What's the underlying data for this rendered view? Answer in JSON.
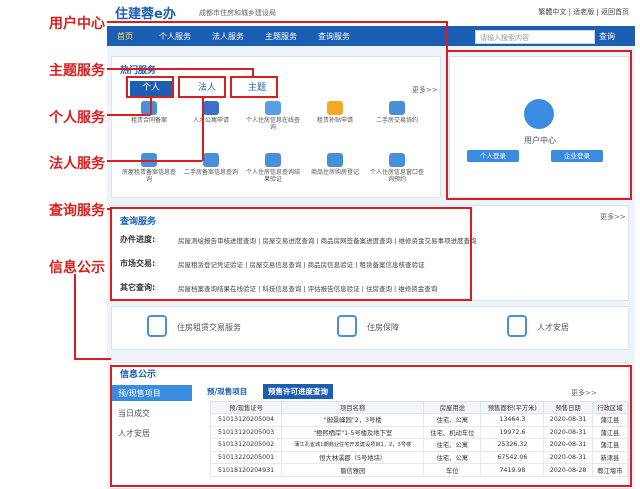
{
  "callouts": [
    "用户中心",
    "主题服务",
    "个人服务",
    "法人服务",
    "查询服务",
    "信息公示"
  ],
  "header": {
    "logo": "住建蓉e办",
    "subtitle": "成都市住房和城乡建设局",
    "toplinks": "繁體中文 | 适老版 | 返回首页"
  },
  "nav": {
    "items": [
      "首页",
      "个人服务",
      "法人服务",
      "主题服务",
      "查询服务"
    ],
    "search_placeholder": "请输入搜索内容",
    "search_label": "查询"
  },
  "hot": {
    "title": "热门服务",
    "tabs": [
      "个人",
      "法人",
      "主题"
    ],
    "more": "更多>>",
    "services": [
      "租赁合同备案",
      "人才公寓申请",
      "个人住房信息在线查询",
      "租赁补贴申请",
      "二手房交易协约",
      "房屋租赁备案信息查询",
      "二手房备案信息查询",
      "个人住房信息查询结果验证",
      "商品住房购房登记",
      "个人住房信息窗口查询预约"
    ]
  },
  "usercenter": {
    "title": "用户中心",
    "personal": "个人登录",
    "company": "企业登录"
  },
  "query": {
    "title": "查询服务",
    "more": "更多>>",
    "rows": [
      {
        "label": "办件进度:",
        "links": "房屋测绘报告审核进度查询 | 房屋交易进度查询 | 商品房网签备案进度查询 | 维修资金交易事项进度查询"
      },
      {
        "label": "市场交易:",
        "links": "房屋租赁登记凭证验证 | 房屋交易信息查询 | 商品房信息验证 | 租赁备案信息核查验证"
      },
      {
        "label": "其它查询:",
        "links": "房屋档案查询结果在线验证 | 科技信息查询 | 评估报告信息验证 | 住房查询 | 维修资金查询"
      }
    ]
  },
  "quicklinks": [
    "住房租赁交易服务",
    "住房保障",
    "人才安居"
  ],
  "info": {
    "title": "信息公示",
    "side": [
      "预/现售项目",
      "当日成交",
      "人才安居"
    ],
    "tabs": [
      "预/现售项目",
      "预售许可进度查询"
    ],
    "more": "更多>>",
    "headers": [
      "预/现售证号",
      "项目名称",
      "房屋用途",
      "预售面积(平方米)",
      "预售日期",
      "行政区域"
    ],
    "rows": [
      [
        "51013120205004",
        "\"御景峰园\"2，3号楼",
        "住宅、公寓",
        "13464.3",
        "2020-08-31",
        "蒲江县"
      ],
      [
        "51013120205003",
        "\"橙熙栖岸\"1-5号楼及地下室",
        "住宅、机动车位",
        "19972.6",
        "2020-08-31",
        "蒲江县"
      ],
      [
        "51013120205002",
        "蒲江孔雀城1期商业住宅开发建设项目1，2，3号楼",
        "住宅、公寓",
        "25326.32",
        "2020-08-31",
        "蒲江县"
      ],
      [
        "51013220205001",
        "恒大林溪郡（5号地块）",
        "住宅、公寓",
        "67542.06",
        "2020-08-31",
        "新津县"
      ],
      [
        "51018120204931",
        "蜀信雅园",
        "车位",
        "7419.98",
        "2020-08-28",
        "郫江堰市"
      ]
    ]
  }
}
